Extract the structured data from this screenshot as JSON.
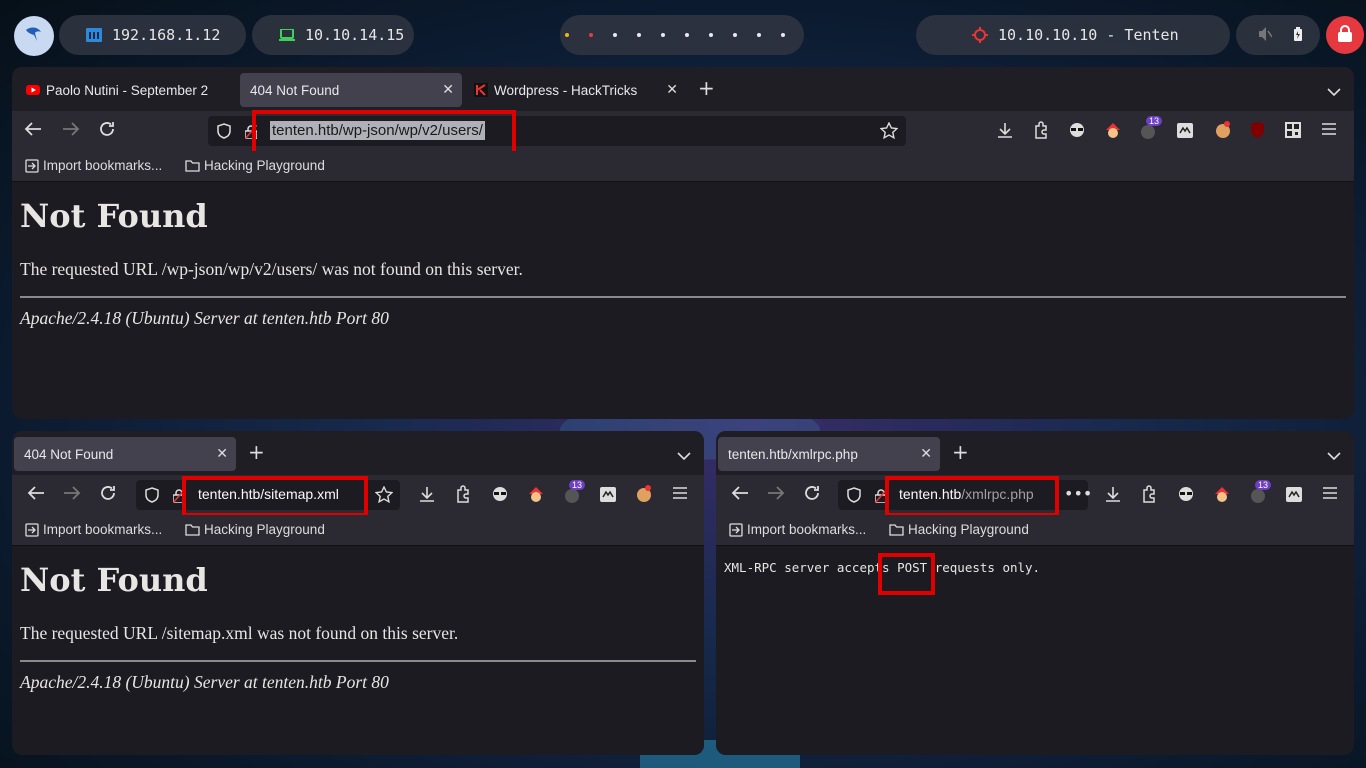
{
  "panel": {
    "ip_local": "192.168.1.12",
    "ip_vpn": "10.10.14.15",
    "target": "10.10.10.10 - Tenten"
  },
  "colors": {
    "accent_red": "#e00000",
    "panel_bg": "#2e3440",
    "browser_bg": "#1c1b22"
  },
  "win_top": {
    "tabs": [
      "Paolo Nutini - September 2",
      "404 Not Found",
      "Wordpress - HackTricks"
    ],
    "url": "tenten.htb/wp-json/wp/v2/users/",
    "badge": "13",
    "bookmarks": [
      "Import bookmarks...",
      "Hacking Playground"
    ],
    "heading": "Not Found",
    "message": "The requested URL /wp-json/wp/v2/users/ was not found on this server.",
    "server": "Apache/2.4.18 (Ubuntu) Server at tenten.htb Port 80"
  },
  "win_left": {
    "tab": "404 Not Found",
    "url": "tenten.htb/sitemap.xml",
    "badge": "13",
    "bookmarks": [
      "Import bookmarks...",
      "Hacking Playground"
    ],
    "heading": "Not Found",
    "message": "The requested URL /sitemap.xml was not found on this server.",
    "server": "Apache/2.4.18 (Ubuntu) Server at tenten.htb Port 80"
  },
  "win_right": {
    "tab": "tenten.htb/xmlrpc.php",
    "url_host": "tenten.htb",
    "url_path": "/xmlrpc.php",
    "badge": "13",
    "bookmarks": [
      "Import bookmarks...",
      "Hacking Playground"
    ],
    "body_pre": "XML-RPC server accepts ",
    "body_post": "POST",
    "body_end": " requests only."
  }
}
